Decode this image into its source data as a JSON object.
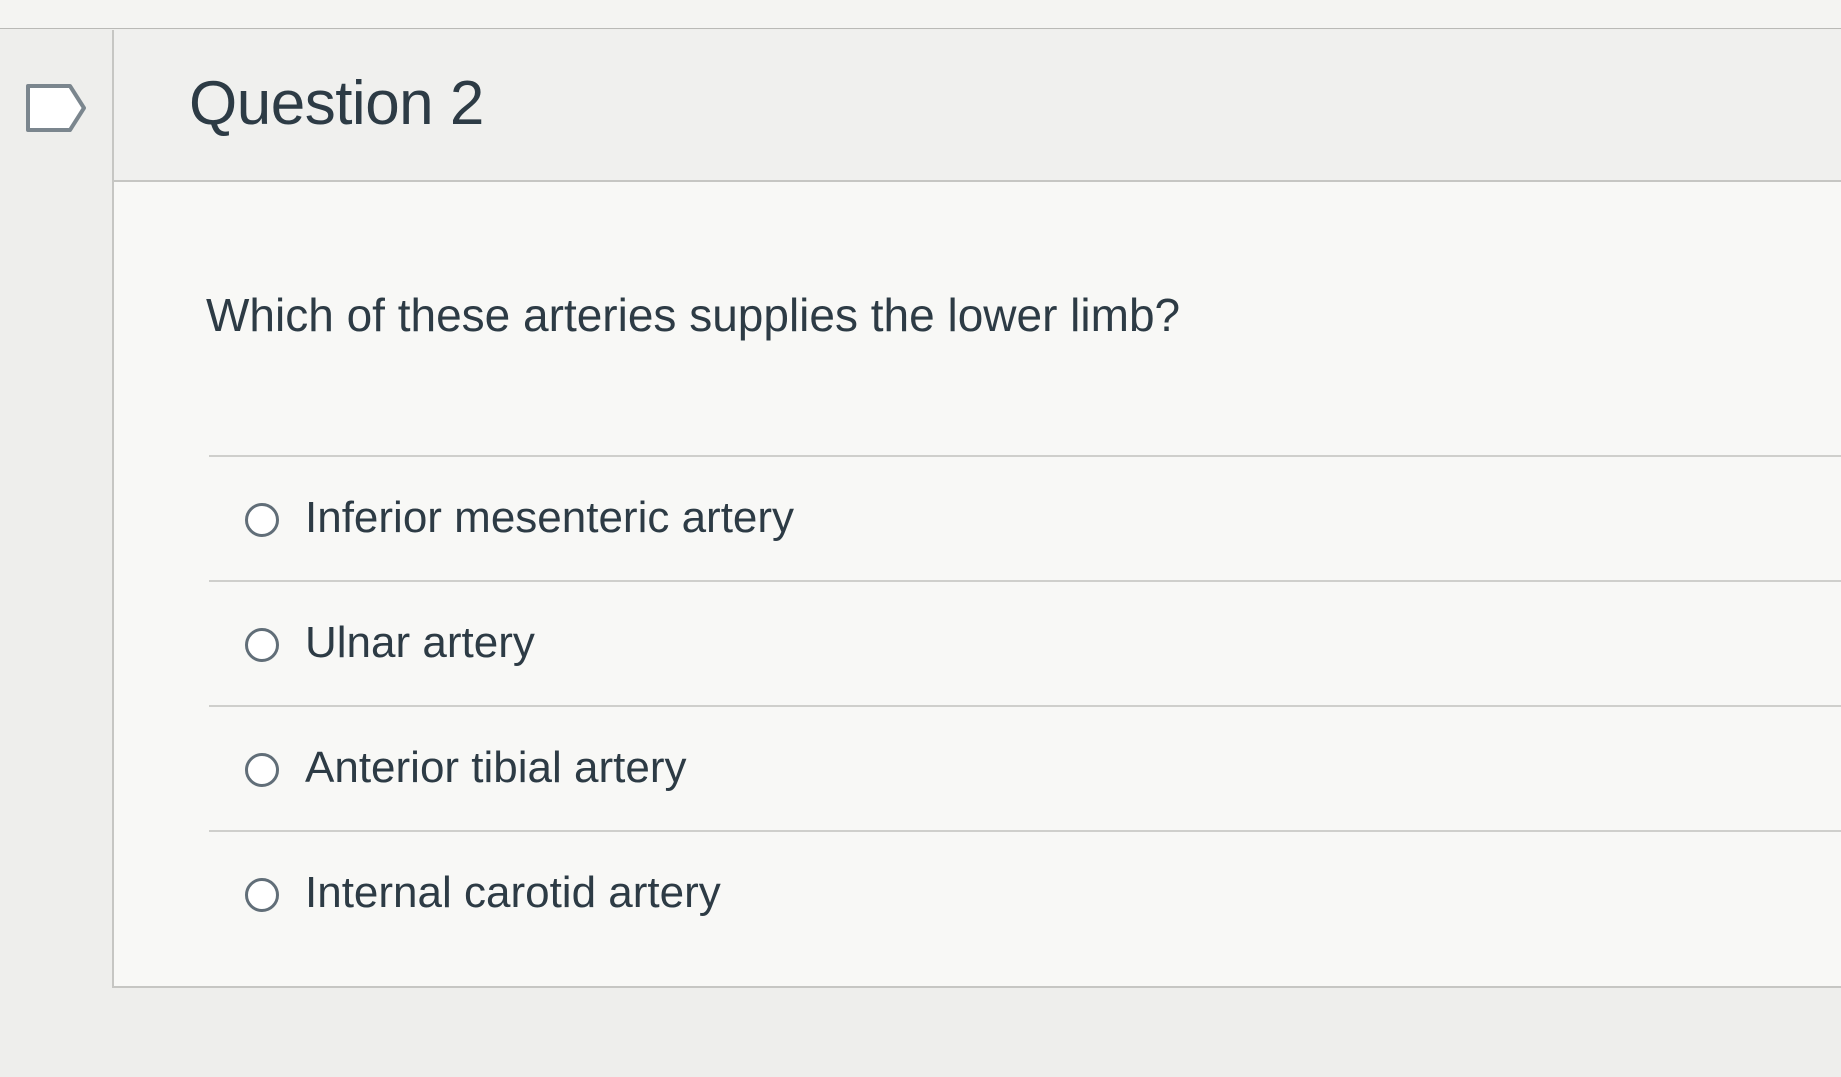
{
  "question": {
    "title": "Question 2",
    "text": "Which of these arteries supplies the lower limb?",
    "answers": [
      {
        "label": "Inferior mesenteric artery",
        "selected": false
      },
      {
        "label": "Ulnar artery",
        "selected": false
      },
      {
        "label": "Anterior tibial artery",
        "selected": false
      },
      {
        "label": "Internal carotid artery",
        "selected": false
      }
    ]
  },
  "icons": {
    "flag": "flag-outline-icon",
    "radio": "radio-unchecked-icon"
  },
  "colors": {
    "text": "#2d3b45",
    "radio_border": "#616e78",
    "divider": "#cfcfcc",
    "card_bg": "#f8f8f6"
  }
}
